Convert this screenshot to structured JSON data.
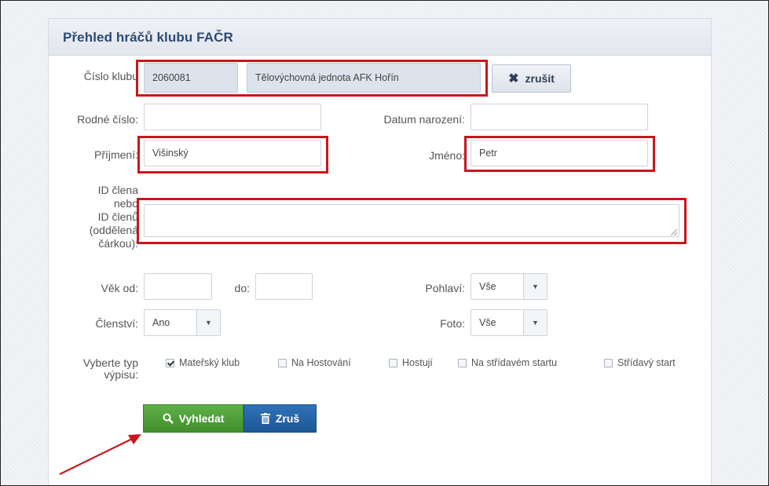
{
  "panel": {
    "title": "Přehled hráčů klubu FAČR"
  },
  "club": {
    "label": "Číslo klubu",
    "number": "2060081",
    "name": "Tělovýchovná jednota AFK Hořín",
    "cancel_label": "zrušit"
  },
  "fields": {
    "birth_number_label": "Rodné číslo:",
    "birth_number_value": "",
    "birth_date_label": "Datum narození:",
    "birth_date_value": "",
    "surname_label": "Příjmení:",
    "surname_value": "Višinský",
    "name_label": "Jméno:",
    "name_value": "Petr",
    "member_id_label_lines": [
      "ID člena",
      "nebo",
      "ID členů",
      "(oddělená",
      "čárkou):"
    ],
    "member_id_value": "",
    "age_from_label": "Věk od:",
    "age_to_label": "do:",
    "gender_label": "Pohlaví:",
    "gender_value": "Vše",
    "membership_label": "Členství:",
    "membership_value": "Ano",
    "photo_label": "Foto:",
    "photo_value": "Vše"
  },
  "listing": {
    "label_lines": [
      "Vyberte typ",
      "výpisu:"
    ],
    "options": [
      {
        "label": "Mateřský klub",
        "checked": true
      },
      {
        "label": "Na Hostování",
        "checked": false
      },
      {
        "label": "Hostují",
        "checked": false
      },
      {
        "label": "Na střídavém startu",
        "checked": false
      },
      {
        "label": "Střídavý start",
        "checked": false
      }
    ]
  },
  "buttons": {
    "search_label": "Vyhledat",
    "clear_label": "Zruš"
  },
  "colors": {
    "highlight": "#c9161c",
    "search_button": "#4a9e35",
    "clear_button": "#2566a8",
    "title": "#2b4a74"
  },
  "icons": {
    "cancel": "close-icon",
    "search": "search-icon",
    "clear": "trash-icon"
  }
}
